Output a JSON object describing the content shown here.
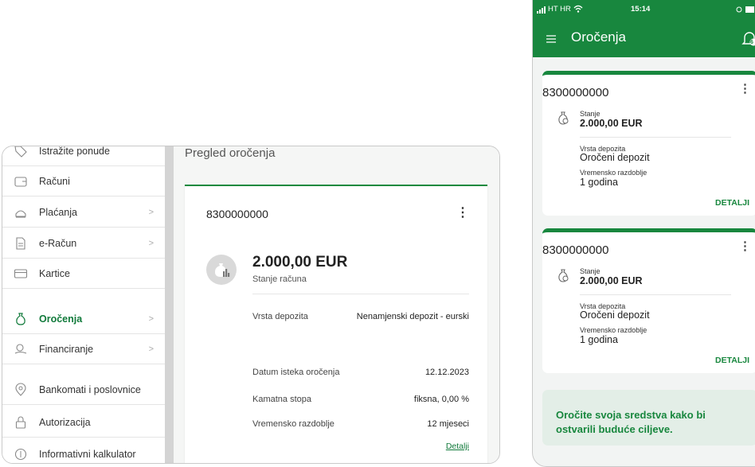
{
  "web": {
    "sidebar": {
      "items": [
        {
          "label": "Istražite ponude",
          "icon": "tag-icon",
          "chevron": false,
          "active": false
        },
        {
          "label": "Računi",
          "icon": "wallet-icon",
          "chevron": false,
          "active": false
        },
        {
          "label": "Plaćanja",
          "icon": "payments-icon",
          "chevron": true,
          "active": false
        },
        {
          "label": "e-Račun",
          "icon": "document-icon",
          "chevron": true,
          "active": false
        },
        {
          "label": "Kartice",
          "icon": "card-icon",
          "chevron": false,
          "active": false
        },
        {
          "label": "Oročenja",
          "icon": "moneybag-icon",
          "chevron": true,
          "active": true
        },
        {
          "label": "Financiranje",
          "icon": "coin-hand-icon",
          "chevron": true,
          "active": false
        },
        {
          "label": "Bankomati i poslovnice",
          "icon": "location-pin-icon",
          "chevron": false,
          "active": false
        },
        {
          "label": "Autorizacija",
          "icon": "lock-icon",
          "chevron": false,
          "active": false
        },
        {
          "label": "Informativni kalkulator",
          "icon": "coin-icon",
          "chevron": false,
          "active": false
        }
      ],
      "chevron_glyph": ">"
    },
    "page_title": "Pregled oročenja",
    "card": {
      "account_number": "8300000000",
      "menu_glyph": "⋮",
      "amount": "2.000,00 EUR",
      "amount_label": "Stanje računa",
      "rows": [
        {
          "label": "Vrsta depozita",
          "value": "Nenamjenski depozit - eurski"
        },
        {
          "label": "Datum isteka oročenja",
          "value": "12.12.2023"
        },
        {
          "label": "Kamatna stopa",
          "value": "fiksna, 0,00 %"
        },
        {
          "label": "Vremensko razdoblje",
          "value": "12 mjeseci"
        }
      ],
      "details_link": "Detalji"
    }
  },
  "phone": {
    "status": {
      "carrier": "HT HR",
      "time": "15:14"
    },
    "title": "Oročenja",
    "notification_badge": "6",
    "cards": [
      {
        "account_number": "8300000000",
        "balance_label": "Stanje",
        "balance": "2.000,00 EUR",
        "type_label": "Vrsta depozita",
        "type": "Oročeni depozit",
        "period_label": "Vremensko razdoblje",
        "period": "1 godina",
        "details": "DETALJI"
      },
      {
        "account_number": "8300000000",
        "balance_label": "Stanje",
        "balance": "2.000,00 EUR",
        "type_label": "Vrsta depozita",
        "type": "Oročeni depozit",
        "period_label": "Vremensko razdoblje",
        "period": "1 godina",
        "details": "DETALJI"
      }
    ],
    "promo": "Oročite svoja sredstva kako bi ostvarili buduće ciljeve."
  },
  "colors": {
    "brand_green": "#18873e",
    "active_green": "#117a3b"
  }
}
